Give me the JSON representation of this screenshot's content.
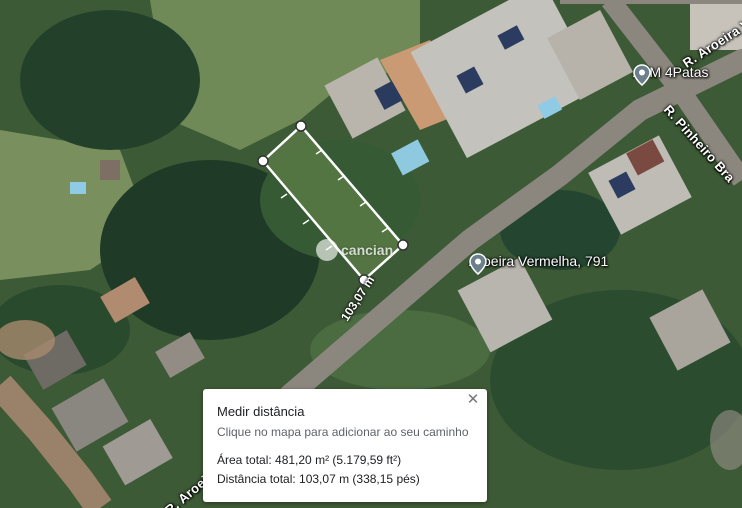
{
  "roads": {
    "aroeira_top": "R. Aroeira V",
    "pinheiro": "R. Pinheiro Bra",
    "aroeira_bottom": "R. Aroeira V"
  },
  "places": {
    "ajm": {
      "label": "AJM 4Patas",
      "icon": "location-pin-icon"
    },
    "aroeira_vermelha": {
      "label": "Aroeira Vermelha, 791",
      "icon": "location-pin-icon"
    }
  },
  "measurement": {
    "distance_label": "103,07 m"
  },
  "watermark": {
    "text": "cancian"
  },
  "panel": {
    "title": "Medir distância",
    "instruction": "Clique no mapa para adicionar ao seu caminho",
    "area": "Área total: 481,20 m² (5.179,59 ft²)",
    "distance": "Distância total: 103,07 m (338,15 pés)",
    "close_icon": "close-icon"
  },
  "colors": {
    "measure_line": "#ffffff",
    "panel_bg": "#ffffff"
  }
}
